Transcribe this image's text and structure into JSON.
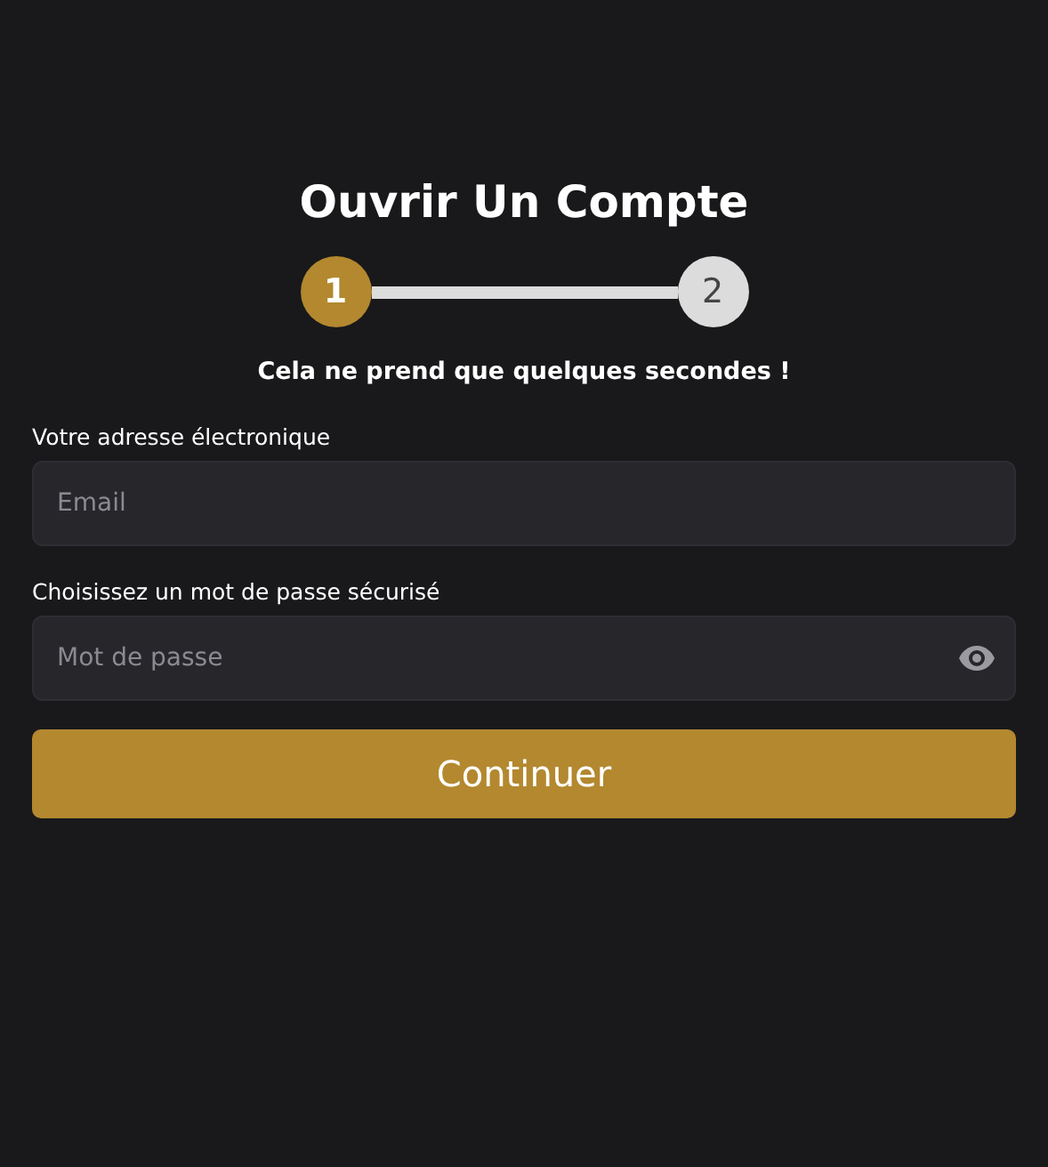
{
  "title": "Ouvrir Un Compte",
  "steps": [
    {
      "label": "1",
      "selected": true
    },
    {
      "label": "2",
      "selected": false
    }
  ],
  "subtitle": "Cela ne prend que quelques secondes !",
  "fields": [
    {
      "label": "Votre adresse électronique",
      "placeholder": "Email",
      "kind": "email"
    },
    {
      "label": "Choisissez un mot de passe sécurisé",
      "placeholder": "Mot de passe",
      "kind": "password"
    }
  ],
  "button": "Continuer"
}
